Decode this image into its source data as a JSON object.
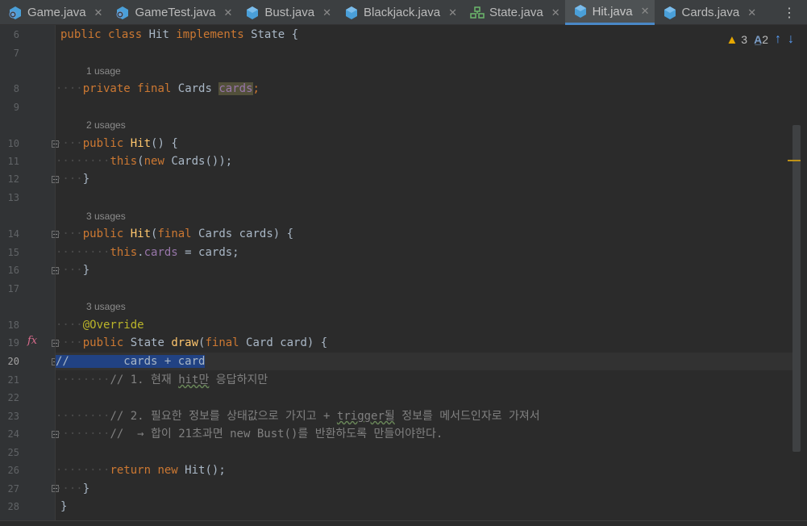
{
  "tabs": [
    {
      "label": "Game.java",
      "icon": "java-class-icon",
      "active": false
    },
    {
      "label": "GameTest.java",
      "icon": "java-class-icon",
      "active": false
    },
    {
      "label": "Bust.java",
      "icon": "java-class-icon",
      "active": false
    },
    {
      "label": "Blackjack.java",
      "icon": "java-class-icon",
      "active": false
    },
    {
      "label": "State.java",
      "icon": "java-interface-icon",
      "active": false
    },
    {
      "label": "Hit.java",
      "icon": "java-class-icon",
      "active": true
    },
    {
      "label": "Cards.java",
      "icon": "java-class-icon",
      "active": false
    }
  ],
  "tab_close_glyph": "✕",
  "tab_menu_glyph": "⋮",
  "inspection": {
    "warnings": "3",
    "typos": "2",
    "typo_glyph": "A̲",
    "up_glyph": "↑",
    "down_glyph": "↓",
    "warn_glyph": "▲"
  },
  "line_numbers": [
    "6",
    "7",
    "8",
    "9",
    "10",
    "11",
    "12",
    "13",
    "14",
    "15",
    "16",
    "17",
    "18",
    "19",
    "20",
    "21",
    "22",
    "23",
    "24",
    "25",
    "26",
    "27",
    "28"
  ],
  "current_line": "20",
  "usages": {
    "u1": "1 usage",
    "u2": "2 usages",
    "u3": "3 usages",
    "u4": "3 usages"
  },
  "code": {
    "l6": {
      "kw1": "public",
      "kw2": "class",
      "name": "Hit",
      "kw3": "implements",
      "iface": "State {"
    },
    "l8": {
      "kw1": "private",
      "kw2": "final",
      "type": "Cards",
      "field": "cards",
      "end": ";"
    },
    "l10": {
      "kw": "public",
      "fn": "Hit",
      "rest": "() {"
    },
    "l11": {
      "kw1": "this",
      "mid": "(",
      "kw2": "new",
      "rest": " Cards());"
    },
    "l12": {
      "text": "}"
    },
    "l14": {
      "kw": "public",
      "fn": "Hit",
      "p1": "(",
      "kw2": "final",
      "rest": " Cards cards) {"
    },
    "l15": {
      "kw": "this",
      "dot": ".",
      "field": "cards",
      "rest": " = cards;"
    },
    "l16": {
      "text": "}"
    },
    "l18": {
      "ann": "@Override"
    },
    "l19": {
      "kw": "public",
      "type": " State ",
      "fn": "draw",
      "p1": "(",
      "kw2": "final",
      "rest": " Card card) {"
    },
    "l20": {
      "sel": "//        cards + card"
    },
    "l21": {
      "c1": "// 1. 현재 ",
      "typo": "hit만",
      "c2": " 응답하지만"
    },
    "l23": {
      "c1": "// 2. 필요한 정보를 상태값으로 가지고 + ",
      "typo": "trigger될",
      "c2": " 정보를 메서드인자로 가져서"
    },
    "l24": {
      "text": "//  → 합이 21초과면 new Bust()를 반환하도록 만들어야한다."
    },
    "l26": {
      "kw1": "return",
      "kw2": "new",
      "rest": " Hit();"
    },
    "l27": {
      "text": "}"
    },
    "l28": {
      "text": "}"
    }
  },
  "colors": {
    "keyword": "#cc7832",
    "function": "#ffc66d",
    "field": "#9876aa",
    "annotation": "#bbb529",
    "comment": "#808080",
    "selection": "#214283"
  }
}
